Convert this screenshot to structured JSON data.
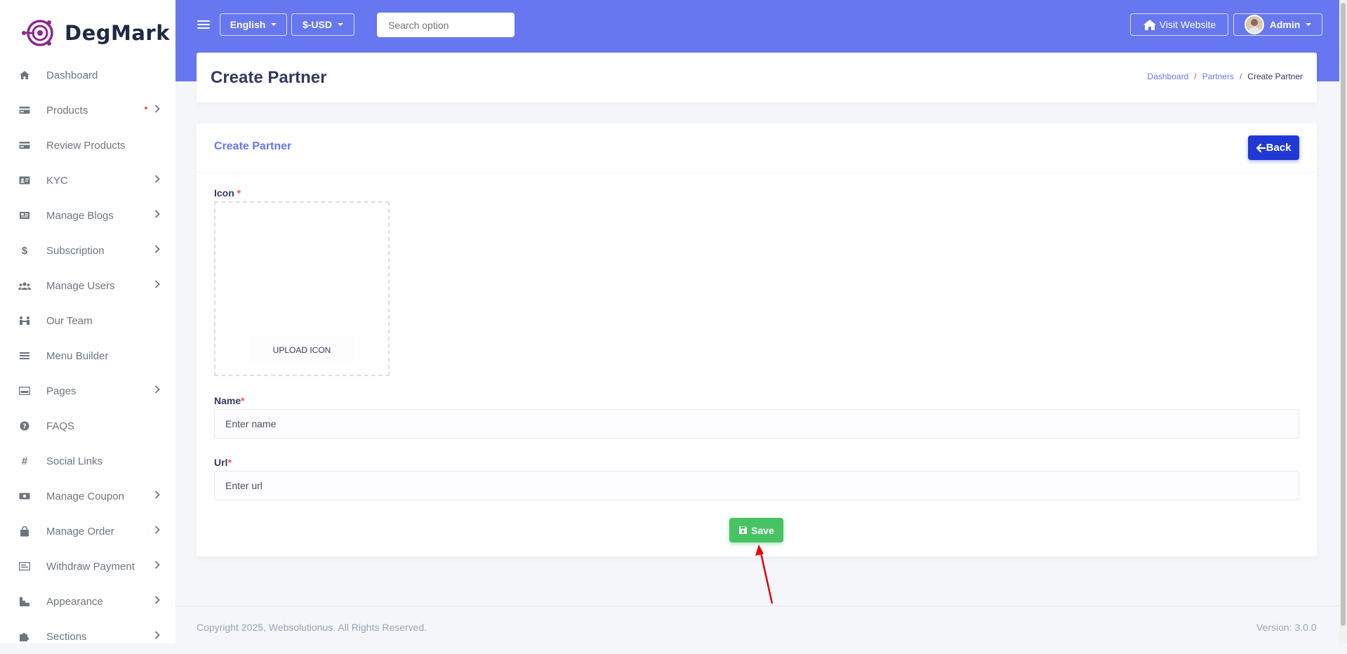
{
  "brand": {
    "name": "DegMark"
  },
  "sidebar": {
    "items": [
      {
        "label": "Dashboard",
        "icon": "home-icon",
        "chevron": false,
        "dot": false
      },
      {
        "label": "Products",
        "icon": "credit-card-icon",
        "chevron": true,
        "dot": true
      },
      {
        "label": "Review Products",
        "icon": "credit-card-icon",
        "chevron": false,
        "dot": false
      },
      {
        "label": "KYC",
        "icon": "id-card-icon",
        "chevron": true,
        "dot": false
      },
      {
        "label": "Manage Blogs",
        "icon": "newspaper-icon",
        "chevron": true,
        "dot": false
      },
      {
        "label": "Subscription",
        "icon": "dollar-icon",
        "chevron": true,
        "dot": false
      },
      {
        "label": "Manage Users",
        "icon": "users-icon",
        "chevron": true,
        "dot": false
      },
      {
        "label": "Our Team",
        "icon": "team-icon",
        "chevron": false,
        "dot": false
      },
      {
        "label": "Menu Builder",
        "icon": "bars-icon",
        "chevron": false,
        "dot": false
      },
      {
        "label": "Pages",
        "icon": "page-icon",
        "chevron": true,
        "dot": false
      },
      {
        "label": "FAQS",
        "icon": "question-circle-icon",
        "chevron": false,
        "dot": false
      },
      {
        "label": "Social Links",
        "icon": "hashtag-icon",
        "chevron": false,
        "dot": false
      },
      {
        "label": "Manage Coupon",
        "icon": "money-bill-icon",
        "chevron": true,
        "dot": false
      },
      {
        "label": "Manage Order",
        "icon": "shopping-bag-icon",
        "chevron": true,
        "dot": false
      },
      {
        "label": "Withdraw Payment",
        "icon": "money-check-icon",
        "chevron": true,
        "dot": false
      },
      {
        "label": "Appearance",
        "icon": "palette-icon",
        "chevron": true,
        "dot": false
      },
      {
        "label": "Sections",
        "icon": "puzzle-icon",
        "chevron": true,
        "dot": false
      }
    ]
  },
  "topbar": {
    "language": "English",
    "currency": "$-USD",
    "search_placeholder": "Search option",
    "visit_website": "Visit Website",
    "user": "Admin"
  },
  "page": {
    "title": "Create Partner",
    "breadcrumb": [
      "Dashboard",
      "Partners",
      "Create Partner"
    ]
  },
  "form": {
    "card_title": "Create Partner",
    "back_label": "Back",
    "icon_label": "Icon",
    "upload_label": "UPLOAD ICON",
    "name_label": "Name",
    "name_placeholder": "Enter name",
    "url_label": "Url",
    "url_placeholder": "Enter url",
    "save_label": "Save",
    "required_mark": "*"
  },
  "footer": {
    "copyright": "Copyright 2025, Websolutionus. All Rights Reserved.",
    "version": "Version: 3.0.0"
  },
  "colors": {
    "primary": "#6777ef",
    "back_button": "#2039d4",
    "save_button": "#47c363",
    "required": "#fc544b",
    "arrow": "#e3000f"
  }
}
